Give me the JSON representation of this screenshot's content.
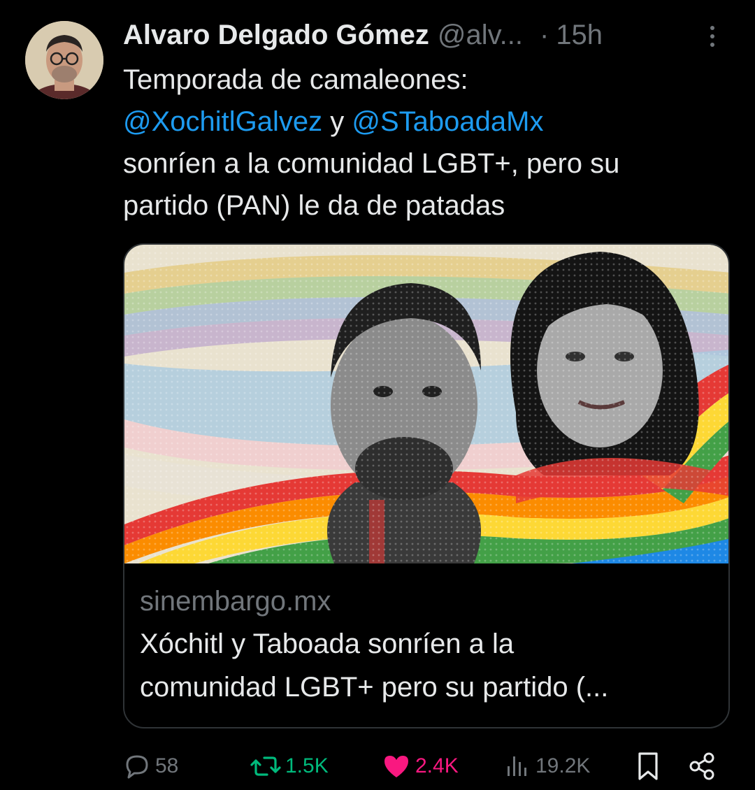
{
  "tweet": {
    "author_name": "Alvaro Delgado Gómez",
    "handle": "@alv...",
    "separator": "·",
    "time": "15h",
    "text_line1": "Temporada de camaleones:",
    "mention1": "@XochitlGalvez",
    "conjunction": " y ",
    "mention2": "@STaboadaMx",
    "text_line3": "sonríen a la comunidad LGBT+, pero su",
    "text_line4": "partido (PAN) le da de patadas"
  },
  "card": {
    "domain": "sinembargo.mx",
    "title_line1": "Xóchitl y Taboada sonríen a la",
    "title_line2": "comunidad LGBT+ pero su partido (..."
  },
  "actions": {
    "replies": "58",
    "retweets": "1.5K",
    "likes": "2.4K",
    "views": "19.2K"
  },
  "colors": {
    "background": "#000000",
    "text": "#e7e9ea",
    "secondary": "#71767b",
    "link": "#1d9bf0",
    "retweet": "#00ba7c",
    "like": "#f91880"
  },
  "icons": [
    "more-icon",
    "reply-icon",
    "retweet-icon",
    "like-icon",
    "views-icon",
    "bookmark-icon",
    "share-icon"
  ]
}
